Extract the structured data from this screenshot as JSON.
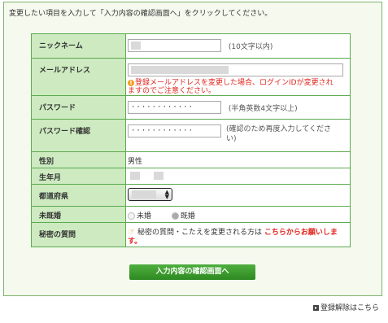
{
  "intro_text": "変更したい項目を入力して「入力内容の確認画面へ」をクリックしてください。",
  "fields": {
    "nickname": {
      "label": "ニックネーム",
      "note": "(10文字以内)"
    },
    "email": {
      "label": "メールアドレス",
      "warning": "登録メールアドレスを変更した場合、ログインIDが変更されますのでご注意ください。"
    },
    "password": {
      "label": "パスワード",
      "value": "············",
      "note": "(半角英数4文字以上)"
    },
    "password_confirm": {
      "label": "パスワード確認",
      "value": "············",
      "note": "(確認のため再度入力してください)"
    },
    "gender": {
      "label": "性別",
      "value": "男性"
    },
    "birthdate": {
      "label": "生年月"
    },
    "prefecture": {
      "label": "都道府県"
    },
    "marital": {
      "label": "未既婚",
      "options": [
        "未婚",
        "既婚"
      ],
      "selected": "既婚"
    },
    "secret_question": {
      "label": "秘密の質問",
      "text": "秘密の質問・こたえを変更される方は",
      "link": "こちらからお願いします。"
    }
  },
  "submit_label": "入力内容の確認画面へ",
  "unregister_label": "登録解除はこちら",
  "colors": {
    "accent_green": "#2e8a21",
    "label_bg": "#cdeac0",
    "warning_red": "#e0261e"
  }
}
